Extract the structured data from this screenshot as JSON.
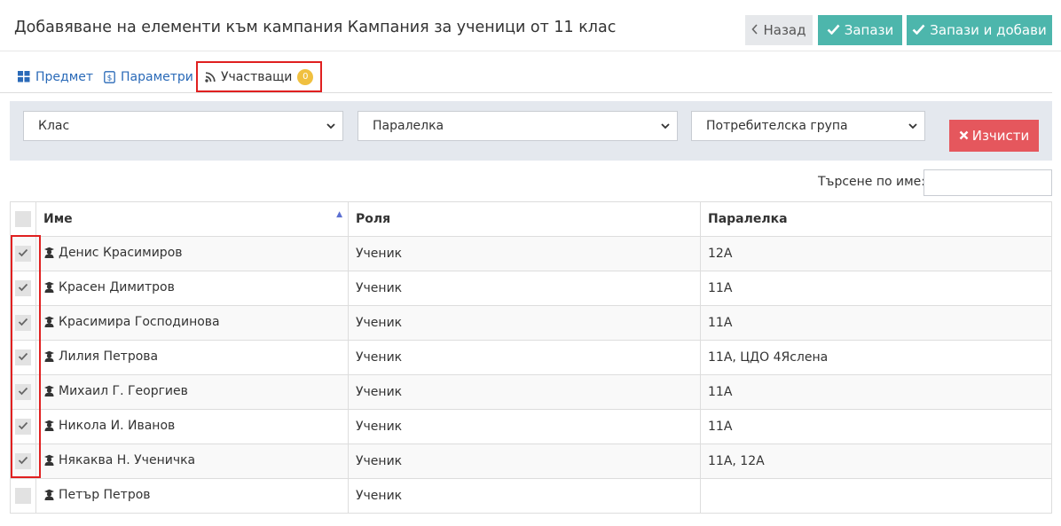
{
  "header": {
    "title": "Добавяване на елементи към кампания Кампания за ученици от 11 клас",
    "back_label": "Назад",
    "save_label": "Запази",
    "save_add_label": "Запази и добави"
  },
  "tabs": [
    {
      "label": "Предмет",
      "icon": "grid-icon"
    },
    {
      "label": "Параметри",
      "icon": "settings-icon"
    },
    {
      "label": "Участващи",
      "icon": "rss-icon",
      "badge": "0",
      "active": true
    }
  ],
  "filters": {
    "class_placeholder": "Клас",
    "paralelka_placeholder": "Паралелка",
    "group_placeholder": "Потребителска група",
    "clear_label": "Изчисти"
  },
  "search": {
    "label": "Търсене по име:",
    "value": ""
  },
  "table": {
    "headers": {
      "name": "Име",
      "role": "Роля",
      "paralelka": "Паралелка"
    },
    "sort_column": "name",
    "sort_direction": "asc",
    "rows": [
      {
        "checked": true,
        "name": "Денис Красимиров",
        "role": "Ученик",
        "paralelka": "12А"
      },
      {
        "checked": true,
        "name": "Красен Димитров",
        "role": "Ученик",
        "paralelka": "11А"
      },
      {
        "checked": true,
        "name": "Красимира Господинова",
        "role": "Ученик",
        "paralelka": "11А"
      },
      {
        "checked": true,
        "name": "Лилия Петрова",
        "role": "Ученик",
        "paralelka": "11А, ЦДО 4Яслена"
      },
      {
        "checked": true,
        "name": "Михаил Г. Георгиев",
        "role": "Ученик",
        "paralelka": "11А"
      },
      {
        "checked": true,
        "name": "Никола И. Иванов",
        "role": "Ученик",
        "paralelka": "11А"
      },
      {
        "checked": true,
        "name": "Някаква Н. Ученичка",
        "role": "Ученик",
        "paralelka": "11А, 12А"
      },
      {
        "checked": false,
        "name": "Петър Петров",
        "role": "Ученик",
        "paralelka": ""
      }
    ]
  },
  "colors": {
    "primary_teal": "#4db6ac",
    "danger_red": "#e5575d",
    "link_blue": "#2a6ab8",
    "badge_yellow": "#f0c040",
    "highlight_red": "#e02020"
  }
}
